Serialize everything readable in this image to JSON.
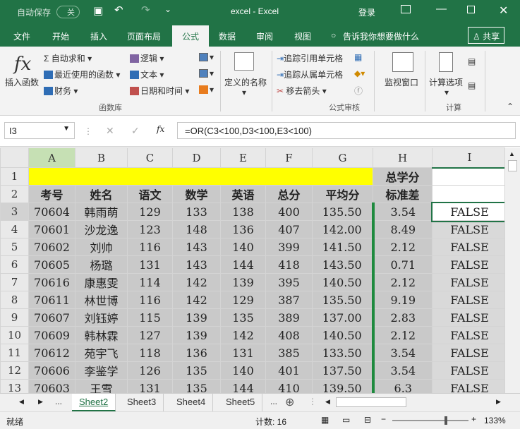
{
  "title_bar": {
    "autosave_label": "自动保存",
    "autosave_state": "关",
    "title": "excel  -  Excel",
    "login": "登录"
  },
  "menu": {
    "tabs": [
      "文件",
      "开始",
      "插入",
      "页面布局",
      "公式",
      "数据",
      "审阅",
      "视图"
    ],
    "tell_me": "告诉我你想要做什么",
    "share": "共享"
  },
  "ribbon": {
    "insert_function": "插入函数",
    "autosum": "自动求和",
    "recent": "最近使用的函数",
    "finance": "财务",
    "logical": "逻辑",
    "text": "文本",
    "datetime": "日期和时间",
    "group_library": "函数库",
    "define_name": "定义的名称",
    "trace_precedents": "追踪引用单元格",
    "trace_dependents": "追踪从属单元格",
    "remove_arrows": "移去箭头",
    "watch_window": "监视窗口",
    "group_audit": "公式审核",
    "calc_options": "计算选项",
    "group_calc": "计算"
  },
  "formula_bar": {
    "name_box": "I3",
    "formula": "=OR(C3<100,D3<100,E3<100)"
  },
  "grid": {
    "col_headers": [
      "A",
      "B",
      "C",
      "D",
      "E",
      "F",
      "G",
      "H",
      "I"
    ],
    "row_numbers": [
      "1",
      "2",
      "3",
      "4",
      "5",
      "6",
      "7",
      "8",
      "9",
      "10",
      "11",
      "12",
      "13"
    ],
    "h1_top": "总学分",
    "h1_bottom": "标准差",
    "headers": [
      "考号",
      "姓名",
      "语文",
      "数学",
      "英语",
      "总分",
      "平均分"
    ],
    "rows": [
      [
        "70604",
        "韩雨萌",
        "129",
        "133",
        "138",
        "400",
        "135.50",
        "3.54",
        "FALSE"
      ],
      [
        "70601",
        "沙龙逸",
        "123",
        "148",
        "136",
        "407",
        "142.00",
        "8.49",
        "FALSE"
      ],
      [
        "70602",
        "刘帅",
        "116",
        "143",
        "140",
        "399",
        "141.50",
        "2.12",
        "FALSE"
      ],
      [
        "70605",
        "杨璐",
        "131",
        "143",
        "144",
        "418",
        "143.50",
        "0.71",
        "FALSE"
      ],
      [
        "70616",
        "康惠雯",
        "114",
        "142",
        "139",
        "395",
        "140.50",
        "2.12",
        "FALSE"
      ],
      [
        "70611",
        "林世博",
        "116",
        "142",
        "129",
        "387",
        "135.50",
        "9.19",
        "FALSE"
      ],
      [
        "70607",
        "刘钰婷",
        "115",
        "139",
        "135",
        "389",
        "137.00",
        "2.83",
        "FALSE"
      ],
      [
        "70609",
        "韩林霖",
        "127",
        "139",
        "142",
        "408",
        "140.50",
        "2.12",
        "FALSE"
      ],
      [
        "70612",
        "苑宇飞",
        "118",
        "136",
        "131",
        "385",
        "133.50",
        "3.54",
        "FALSE"
      ],
      [
        "70606",
        "李鉴学",
        "126",
        "135",
        "140",
        "401",
        "137.50",
        "3.54",
        "FALSE"
      ],
      [
        "70603",
        "王雪",
        "131",
        "135",
        "144",
        "410",
        "139.50",
        "6.3",
        "FALSE"
      ]
    ]
  },
  "sheets": {
    "tabs": [
      "Sheet2",
      "Sheet3",
      "Sheet4",
      "Sheet5"
    ],
    "more": "..."
  },
  "status": {
    "ready": "就绪",
    "count": "计数: 16",
    "zoom": "133%"
  },
  "colors": {
    "brand": "#217346",
    "yellow": "#ffff00",
    "gray": "#c9c9c9"
  }
}
